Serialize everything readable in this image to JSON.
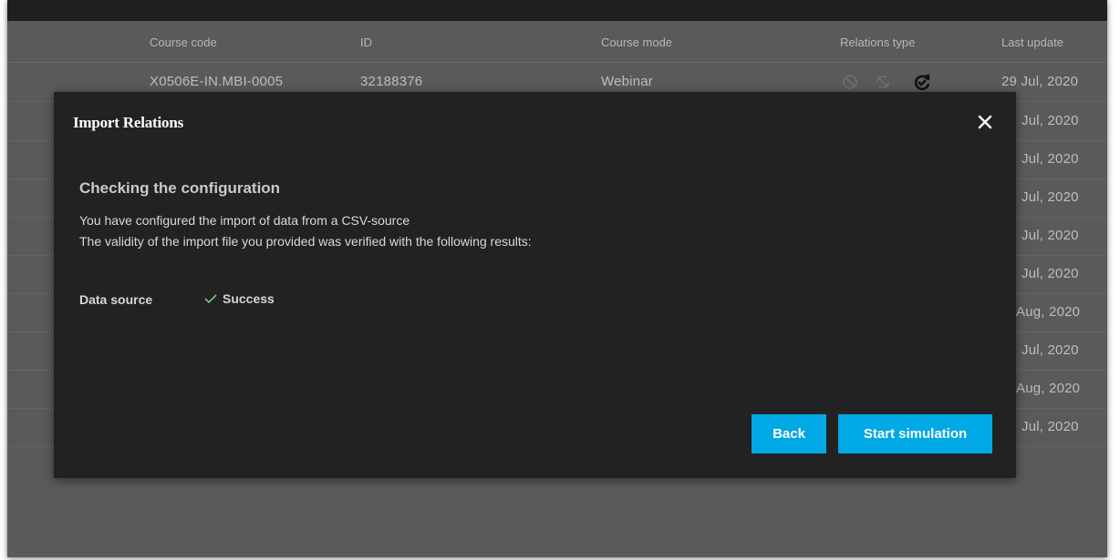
{
  "table": {
    "headers": {
      "course_code": "Course code",
      "id": "ID",
      "course_mode": "Course mode",
      "relations_type": "Relations type",
      "last_update": "Last update"
    },
    "first_row": {
      "course_code": "X0506E-IN.MBI-0005",
      "id": "32188376",
      "course_mode": "Webinar",
      "last_update": "29 Jul, 2020"
    },
    "partial_dates": [
      "Jul, 2020",
      "Jul, 2020",
      "Jul, 2020",
      "Jul, 2020",
      "Jul, 2020",
      "Aug, 2020",
      "Jul, 2020",
      "Aug, 2020",
      "Jul, 2020"
    ]
  },
  "modal": {
    "title": "Import Relations",
    "section_title": "Checking the configuration",
    "description_line1": "You have configured the import of data from a CSV-source",
    "description_line2": "The validity of the import file you provided was verified with the following results:",
    "data_source_label": "Data source",
    "data_source_status": "Success",
    "back_label": "Back",
    "start_label": "Start simulation"
  },
  "colors": {
    "accent": "#00a8e6",
    "modal_bg": "#222222",
    "page_bg": "#5a5a5a",
    "success_check": "#7cc47a"
  },
  "icons": [
    "close-icon",
    "check-icon",
    "relation-disabled-icon",
    "relation-sync-icon"
  ]
}
